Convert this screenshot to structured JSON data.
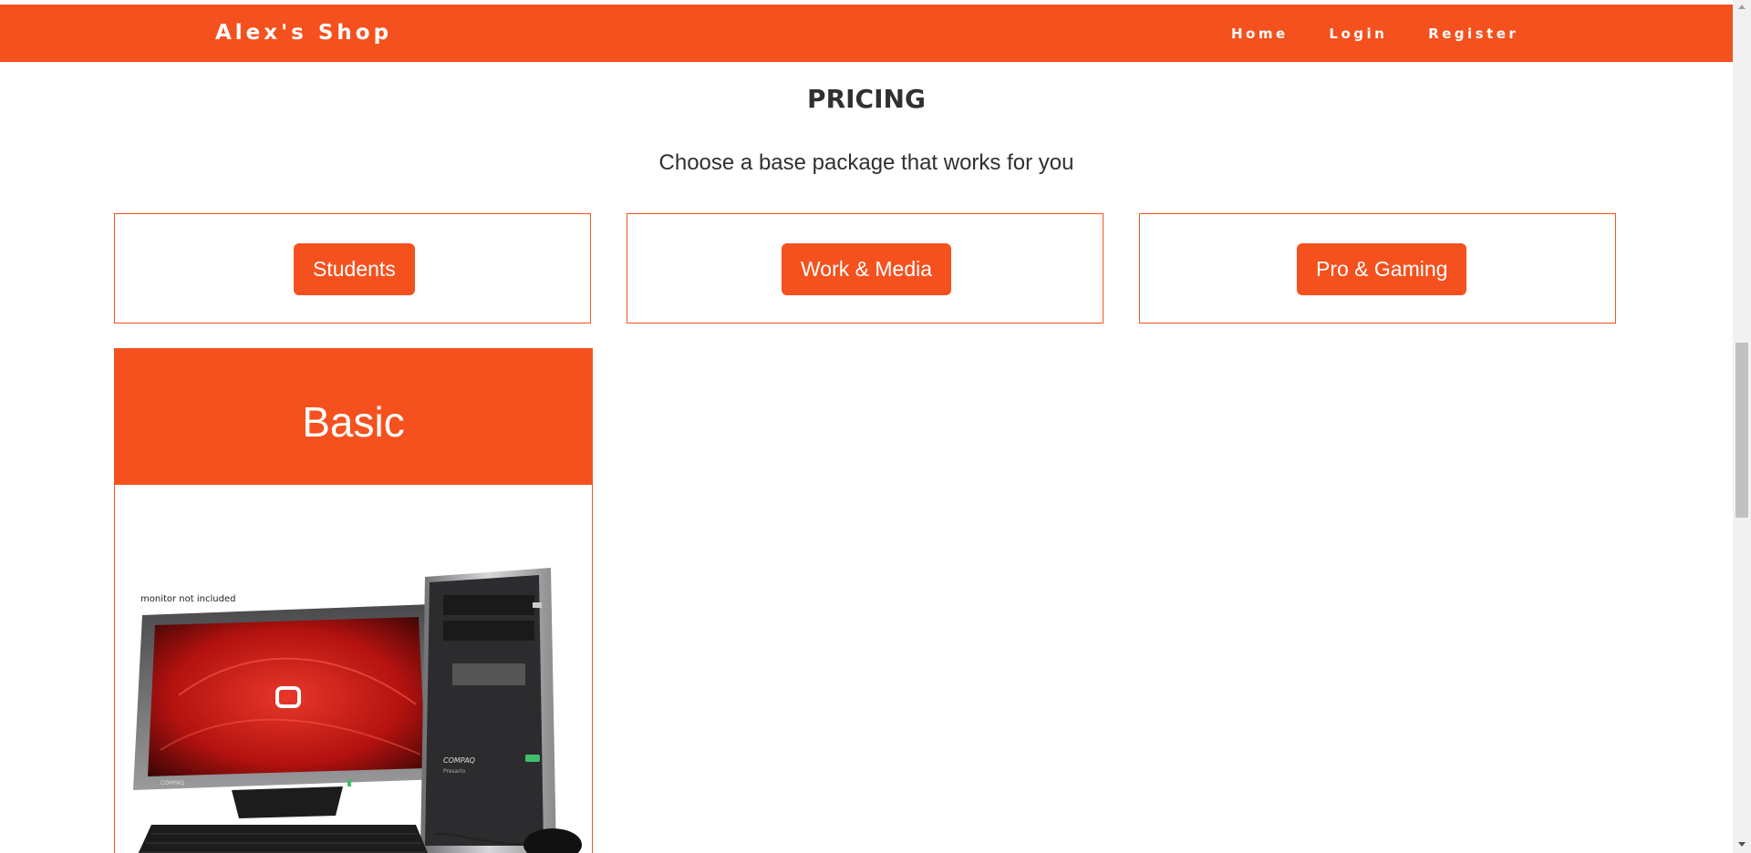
{
  "navbar": {
    "brand": "Alex's Shop",
    "links": [
      "Home",
      "Login",
      "Register"
    ]
  },
  "pricing": {
    "title": "PRICING",
    "subtitle": "Choose a base package that works for you",
    "packages": [
      "Students",
      "Work & Media",
      "Pro & Gaming"
    ]
  },
  "plan": {
    "name": "Basic",
    "image_note": "monitor not included",
    "monitor_brand": "COMPAQ",
    "tower_brand": "COMPAQ",
    "tower_model": "Presario"
  },
  "colors": {
    "accent": "#f4511e",
    "text": "#303030"
  }
}
